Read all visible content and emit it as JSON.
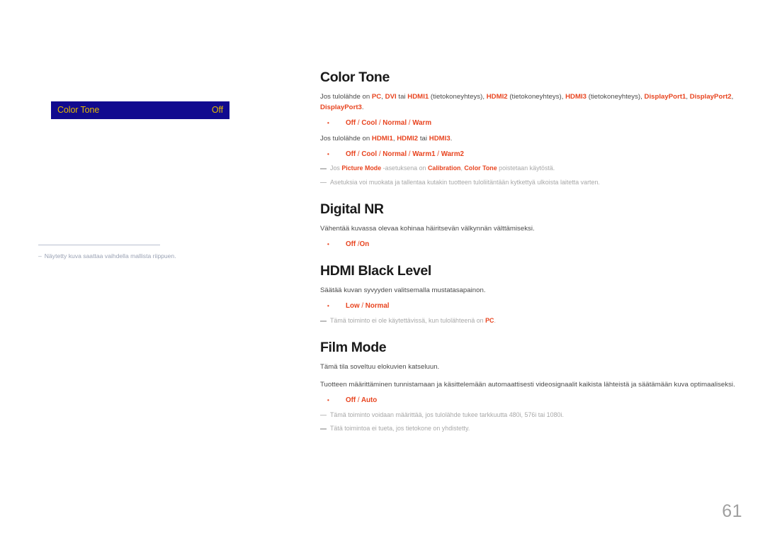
{
  "page": {
    "number": "61",
    "language": "fi"
  },
  "osd_menu": {
    "label": "Color Tone",
    "value": "Off"
  },
  "left_footnote": {
    "dash": "–",
    "text": "Näytetty kuva saattaa vaihdella mallista riippuen."
  },
  "sections": [
    {
      "id": "color-tone",
      "title": "Color Tone",
      "intro_parts": [
        {
          "t": "Jos tulolähde on ",
          "hl": false
        },
        {
          "t": "PC",
          "hl": true
        },
        {
          "t": ", ",
          "hl": false
        },
        {
          "t": "DVI",
          "hl": true
        },
        {
          "t": " tai ",
          "hl": false
        },
        {
          "t": "HDMI1",
          "hl": true
        },
        {
          "t": " (tietokoneyhteys), ",
          "hl": false
        },
        {
          "t": "HDMI2",
          "hl": true
        },
        {
          "t": " (tietokoneyhteys), ",
          "hl": false
        },
        {
          "t": "HDMI3",
          "hl": true
        },
        {
          "t": " (tietokoneyhteys), ",
          "hl": false
        },
        {
          "t": "DisplayPort1",
          "hl": true
        },
        {
          "t": ", ",
          "hl": false
        },
        {
          "t": "DisplayPort2",
          "hl": true
        },
        {
          "t": ", ",
          "hl": false
        },
        {
          "t": "DisplayPort3",
          "hl": true
        },
        {
          "t": ".",
          "hl": false
        }
      ],
      "options_1": "Off / Cool / Normal / Warm",
      "intro2_parts": [
        {
          "t": "Jos tulolähde on ",
          "hl": false
        },
        {
          "t": "HDMI1",
          "hl": true
        },
        {
          "t": ", ",
          "hl": false
        },
        {
          "t": "HDMI2",
          "hl": true
        },
        {
          "t": " tai ",
          "hl": false
        },
        {
          "t": "HDMI3",
          "hl": true
        },
        {
          "t": ".",
          "hl": false
        }
      ],
      "options_2": "Off / Cool / Normal / Warm1 / Warm2",
      "note_1_parts": [
        {
          "t": "Jos ",
          "hl": false
        },
        {
          "t": "Picture Mode",
          "hl": true
        },
        {
          "t": " -asetuksena on ",
          "hl": false
        },
        {
          "t": "Calibration",
          "hl": true
        },
        {
          "t": ", ",
          "hl": false
        },
        {
          "t": "Color Tone",
          "hl": true
        },
        {
          "t": " poistetaan käytöstä.",
          "hl": false
        }
      ],
      "note_2_parts": [
        {
          "t": "Asetuksia voi muokata ja tallentaa kutakin tuotteen tuloliitäntään kytkettyä ulkoista laitetta varten.",
          "hl": false
        }
      ]
    },
    {
      "id": "digital-nr",
      "title": "Digital NR",
      "description": "Vähentää kuvassa olevaa kohinaa häiritsevän välkynnän välttämiseksi.",
      "options_1": "Off /On"
    },
    {
      "id": "hdmi-black-level",
      "title": "HDMI Black Level",
      "description": "Säätää kuvan syvyyden valitsemalla mustatasapainon.",
      "options_1": "Low / Normal",
      "note_1_parts": [
        {
          "t": "Tämä toiminto ei ole käytettävissä, kun tulolähteenä on ",
          "hl": false
        },
        {
          "t": "PC",
          "hl": true
        },
        {
          "t": ".",
          "hl": false
        }
      ]
    },
    {
      "id": "film-mode",
      "title": "Film Mode",
      "description": "Tämä tila soveltuu elokuvien katseluun.",
      "description_2": "Tuotteen määrittäminen tunnistamaan ja käsittelemään automaattisesti videosignaalit kaikista lähteistä ja säätämään kuva optimaaliseksi.",
      "options_1": "Off / Auto",
      "note_1_parts": [
        {
          "t": "Tämä toiminto voidaan määrittää, jos tulolähde tukee tarkkuutta 480i, 576i tai 1080i.",
          "hl": false
        }
      ],
      "note_2_parts": [
        {
          "t": "Tätä toimintoa ei tueta, jos tietokone on yhdistetty.",
          "hl": false
        }
      ]
    }
  ],
  "colors": {
    "accent_red": "#e8441f",
    "osd_background": "#110a8f",
    "osd_text": "#e3b900",
    "body_text": "#4a4a4a",
    "note_text": "#a8a8a8",
    "page_number": "#a0a0a0"
  }
}
